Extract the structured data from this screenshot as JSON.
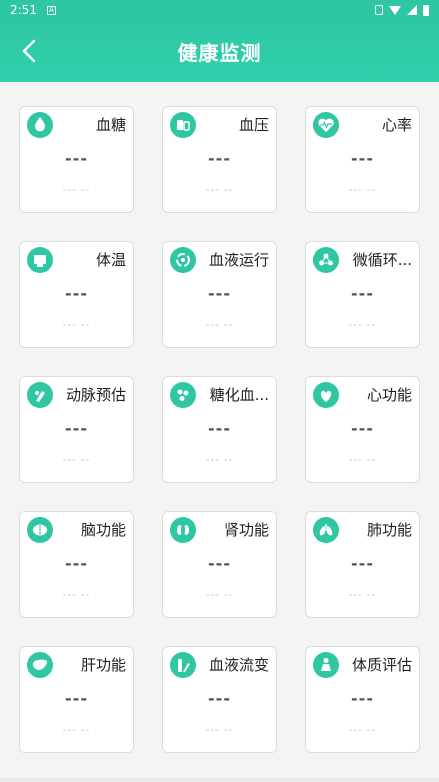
{
  "status": {
    "time": "2:51",
    "notif": "A"
  },
  "header": {
    "title": "健康监测"
  },
  "cards": [
    {
      "name": "血糖",
      "value": "---",
      "sub": "--- --",
      "icon": "drop-icon"
    },
    {
      "name": "血压",
      "value": "---",
      "sub": "--- --",
      "icon": "blood-pressure-icon"
    },
    {
      "name": "心率",
      "value": "---",
      "sub": "--- --",
      "icon": "heart-rate-icon"
    },
    {
      "name": "体温",
      "value": "---",
      "sub": "--- --",
      "icon": "thermometer-icon"
    },
    {
      "name": "血液运行",
      "value": "---",
      "sub": "--- --",
      "icon": "circulation-icon"
    },
    {
      "name": "微循环...",
      "value": "---",
      "sub": "--- --",
      "icon": "microcirculation-icon"
    },
    {
      "name": "动脉预估",
      "value": "---",
      "sub": "--- --",
      "icon": "artery-icon"
    },
    {
      "name": "糖化血...",
      "value": "---",
      "sub": "--- --",
      "icon": "glycated-icon"
    },
    {
      "name": "心功能",
      "value": "---",
      "sub": "--- --",
      "icon": "heart-icon"
    },
    {
      "name": "脑功能",
      "value": "---",
      "sub": "--- --",
      "icon": "brain-icon"
    },
    {
      "name": "肾功能",
      "value": "---",
      "sub": "--- --",
      "icon": "kidney-icon"
    },
    {
      "name": "肺功能",
      "value": "---",
      "sub": "--- --",
      "icon": "lung-icon"
    },
    {
      "name": "肝功能",
      "value": "---",
      "sub": "--- --",
      "icon": "liver-icon"
    },
    {
      "name": "血液流变",
      "value": "---",
      "sub": "--- --",
      "icon": "blood-flow-icon"
    },
    {
      "name": "体质评估",
      "value": "---",
      "sub": "--- --",
      "icon": "body-assessment-icon"
    }
  ],
  "colors": {
    "accent": "#2fc7a3",
    "card_border": "#dcdcdc",
    "background": "#f4f4f4"
  }
}
